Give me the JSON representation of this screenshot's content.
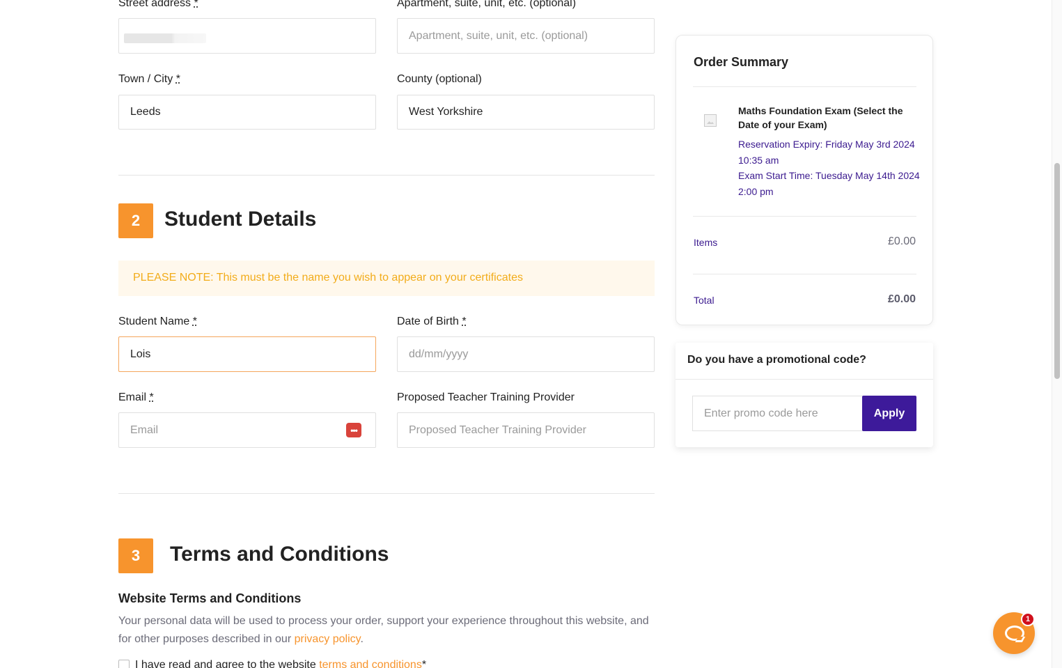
{
  "address": {
    "street_label": "Street address",
    "apartment_label": "Apartment, suite, unit, etc. (optional)",
    "apartment_placeholder": "Apartment, suite, unit, etc. (optional)",
    "town_label": "Town / City",
    "town_value": "Leeds",
    "county_label": "County (optional)",
    "county_value": "West Yorkshire",
    "required_mark": "*"
  },
  "student_section": {
    "step_number": "2",
    "title": "Student Details",
    "notice": "PLEASE NOTE: This must be the name you wish to appear on your certificates",
    "student_name_label": "Student Name",
    "student_name_value": "Lois",
    "dob_label": "Date of Birth",
    "dob_placeholder": "dd/mm/yyyy",
    "email_label": "Email",
    "email_placeholder": "Email",
    "email_icon": "password-manager-icon",
    "provider_label": "Proposed Teacher Training Provider",
    "provider_placeholder": "Proposed Teacher Training Provider"
  },
  "terms_section": {
    "step_number": "3",
    "title": "Terms and Conditions",
    "subheading": "Website Terms and Conditions",
    "text_before_link": "Your personal data will be used to process your order, support your experience throughout this website, and for other purposes described in our ",
    "privacy_link": "privacy policy",
    "text_after_link": ".",
    "checkbox_text": "I have read and agree to the website ",
    "terms_link": "terms and conditions",
    "checkbox_required": " *"
  },
  "order_summary": {
    "title": "Order Summary",
    "product_name": "Maths Foundation Exam (Select the Date of your Exam)",
    "reservation_expiry": "Reservation Expiry: Friday May 3rd 2024 10:35 am",
    "exam_start": "Exam Start Time: Tuesday May 14th 2024 2:00 pm",
    "items_label": "Items",
    "items_value": "£0.00",
    "total_label": "Total",
    "total_value": "£0.00"
  },
  "promo": {
    "title": "Do you have a promotional code?",
    "placeholder": "Enter promo code here",
    "apply_label": "Apply"
  },
  "chat": {
    "badge_count": "1"
  },
  "colors": {
    "accent_orange": "#f7942d",
    "brand_purple": "#3d1a9a",
    "notice_text": "#f2ac1a",
    "notice_bg": "#fff8ec"
  }
}
